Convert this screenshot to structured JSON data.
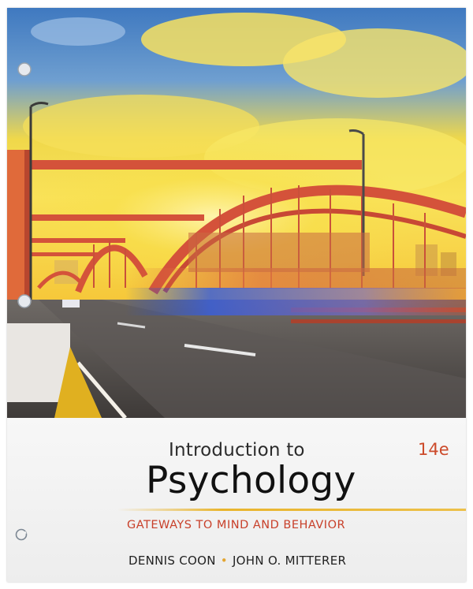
{
  "book": {
    "title_intro": "Introduction to",
    "title_main": "Psychology",
    "edition": "14e",
    "subtitle": "GATEWAYS TO MIND AND BEHAVIOR",
    "author_1": "DENNIS COON",
    "author_separator": "•",
    "author_2": "JOHN O. MITTERER"
  },
  "colors": {
    "edition": "#cc4a2a",
    "subtitle": "#c8402a",
    "rule": "#e9b52e",
    "bridge": "#d4523a",
    "sky_yellow": "#f5d21e",
    "sky_blue": "#4f86c6"
  },
  "icons": {
    "publisher_logo": "cengage-logo-icon",
    "binder_tabs": "binder-ring-icon"
  }
}
